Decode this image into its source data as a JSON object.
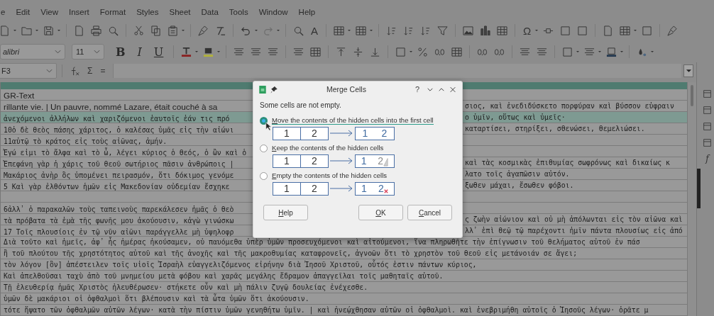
{
  "menu": [
    "e",
    "Edit",
    "View",
    "Insert",
    "Format",
    "Styles",
    "Sheet",
    "Data",
    "Tools",
    "Window",
    "Help"
  ],
  "standard_toolbar": {
    "spelling_glyph": "A",
    "special_character_glyph": "Ω"
  },
  "formatting_toolbar": {
    "font_name": "alibri",
    "font_size": "11",
    "bold": "B",
    "italic": "I",
    "underline": "U"
  },
  "formula_bar": {
    "cell_reference": "F3",
    "sum_glyph": "Σ",
    "equals_glyph": "="
  },
  "sidebar": {
    "functions_glyph": "f"
  },
  "sheet": {
    "rows": [
      {
        "kind": "heading",
        "left": "GR-Text",
        "selected": false
      },
      {
        "kind": "latin",
        "left": "rillante vie. | Un pauvre, nommé Lazare, était couché à sa",
        "right": "σιος, καὶ ἐνεδιδύσκετο πορφύραν καὶ βύσσον εὐφραιν",
        "selected": false
      },
      {
        "kind": "split",
        "left": "ἀνεχόμενοι ἀλλήλων καὶ χαριζόμενοι ἑαυτοῖς ἐάν τις πρό",
        "right": "ο ὑμῖν, οὕτως καὶ ὑμεῖς·",
        "selected": true
      },
      {
        "kind": "split",
        "left": "10ὁ δὲ θεὸς πάσης χάριτος, ὁ καλέσας ὑμᾶς εἰς τὴν αἰώνι",
        "right": "καταρτίσει, στηρίξει, σθενώσει, θεμελιώσει.",
        "selected": false
      },
      {
        "kind": "split",
        "left": "11αὐτῷ τὸ κράτος εἰς τοὺς αἰῶνας, ἀμήν.",
        "selected": false
      },
      {
        "kind": "split",
        "left": "Ἐγώ εἰμι τὸ ἄλφα καὶ τὸ ὦ, λέγει κύριος ὁ θεός, ὁ ὢν καὶ ὁ",
        "selected": false
      },
      {
        "kind": "split",
        "left": "Ἐπεφάνη γὰρ ἡ χάρις τοῦ θεοῦ σωτήριος πᾶσιν ἀνθρώποις |",
        "right": "καὶ τὰς κοσμικὰς ἐπιθυμίας σωφρόνως καὶ δικαίως κ",
        "selected": false
      },
      {
        "kind": "split",
        "left": "Μακάριος ἀνὴρ ὃς ὑπομένει πειρασμόν, ὅτι δόκιμος γενόμε",
        "right": "λατο τοῖς ἀγαπῶσιν αὐτόν.",
        "selected": false
      },
      {
        "kind": "split",
        "left": "5 Καὶ γὰρ ἐλθόντων ἡμῶν εἰς Μακεδονίαν οὐδεμίαν ἔσχηκε",
        "right": "ξωθεν μάχαι, ἔσωθεν φόβοι.",
        "selected": false
      },
      {
        "kind": "blank",
        "selected": false
      },
      {
        "kind": "split",
        "left": "6ἀλλ᾽ ὁ παρακαλῶν τοὺς ταπεινοὺς παρεκάλεσεν ἡμᾶς ὁ θεὸ",
        "selected": false
      },
      {
        "kind": "split",
        "left": "τὰ πρόβατα τὰ ἐμὰ τῆς φωνῆς μου ἀκούουσιν, κἀγὼ γινώσκω",
        "right": "ς ζωὴν αἰώνιον καὶ οὐ μὴ ἀπόλωνται εἰς τὸν αἰῶνα καὶ",
        "selected": false
      },
      {
        "kind": "split",
        "left": "17 Τοῖς πλουσίοις ἐν τῷ νῦν αἰῶνι παράγγελλε μὴ ὑψηλοφρ",
        "right": "λλ᾽ ἐπὶ θεῷ τῷ παρέχοντι ἡμῖν πάντα πλουσίως εἰς ἀπό",
        "selected": false
      },
      {
        "kind": "full",
        "text": "Διὰ τοῦτο καὶ ἡμεῖς, ἀφ᾽ ἧς ἡμέρας ἠκούσαμεν, οὐ παυόμεθα ὑπὲρ ὑμῶν προσευχόμενοι καὶ αἰτούμενοι, ἵνα πληρωθῆτε τὴν ἐπίγνωσιν τοῦ θελήματος αὐτοῦ ἐν πάσ",
        "selected": false
      },
      {
        "kind": "full",
        "text": "ἢ τοῦ πλούτου τῆς χρηστότητος αὐτοῦ καὶ τῆς ἀνοχῆς καὶ τῆς μακροθυμίας καταφρονεῖς, ἀγνοῶν ὅτι τὸ χρηστὸν τοῦ θεοῦ εἰς μετάνοιάν σε ἄγει;",
        "selected": false
      },
      {
        "kind": "full",
        "text": "τὸν λόγον [ὃν] ἀπέστειλεν τοῖς υἱοῖς Ἰσραὴλ εὐαγγελιζόμενος εἰρήνην διὰ Ἰησοῦ Χριστοῦ, οὗτός ἐστιν πάντων κύριος,",
        "selected": false
      },
      {
        "kind": "full",
        "text": "Καὶ ἀπελθοῦσαι ταχὺ ἀπὸ τοῦ μνημείου μετὰ φόβου καὶ χαρᾶς μεγάλης ἔδραμον ἀπαγγεῖλαι τοῖς μαθηταῖς αὐτοῦ.",
        "selected": false
      },
      {
        "kind": "full",
        "text": "Τῇ ἐλευθερίᾳ ἡμᾶς Χριστὸς ἠλευθέρωσεν· στήκετε οὖν καὶ μὴ πάλιν ζυγῷ δουλείας ἐνέχεσθε.",
        "selected": false
      },
      {
        "kind": "full",
        "text": "ὑμῶν δὲ μακάριοι οἱ ὀφθαλμοὶ ὅτι βλέπουσιν καὶ τὰ ὦτα ὑμῶν ὅτι ἀκούουσιν.",
        "selected": false
      },
      {
        "kind": "full",
        "text": "τότε ἥψατο τῶν ὀφθαλμῶν αὐτῶν λέγων· κατὰ τὴν πίστιν ὑμῶν γενηθήτω ὑμῖν. | καὶ ἠνεῴχθησαν αὐτῶν οἱ ὀφθαλμοὶ. καὶ ἐνεβριμήθη αὐτοῖς ὁ Ἰησοῦς λέγων· ὁρᾶτε μ",
        "selected": false
      }
    ]
  },
  "dialog": {
    "title": "Merge Cells",
    "help_glyph": "?",
    "message": "Some cells are not empty.",
    "options": [
      {
        "kind": "move",
        "label": "Move the contents of the hidden cells into the first cell",
        "selected": true,
        "before": [
          "1",
          "2"
        ],
        "after": [
          "1",
          "2"
        ]
      },
      {
        "kind": "keep",
        "label": "Keep the contents of the hidden cells",
        "selected": false,
        "before": [
          "1",
          "2"
        ],
        "after": [
          "1",
          "2"
        ]
      },
      {
        "kind": "empty",
        "label": "Empty the contents of the hidden cells",
        "selected": false,
        "before": [
          "1",
          "2"
        ],
        "after": [
          "1",
          "2"
        ]
      }
    ],
    "buttons": [
      {
        "kind": "help",
        "label": "Help"
      },
      {
        "kind": "ok",
        "label": "OK"
      },
      {
        "kind": "cancel",
        "label": "Cancel"
      }
    ]
  }
}
